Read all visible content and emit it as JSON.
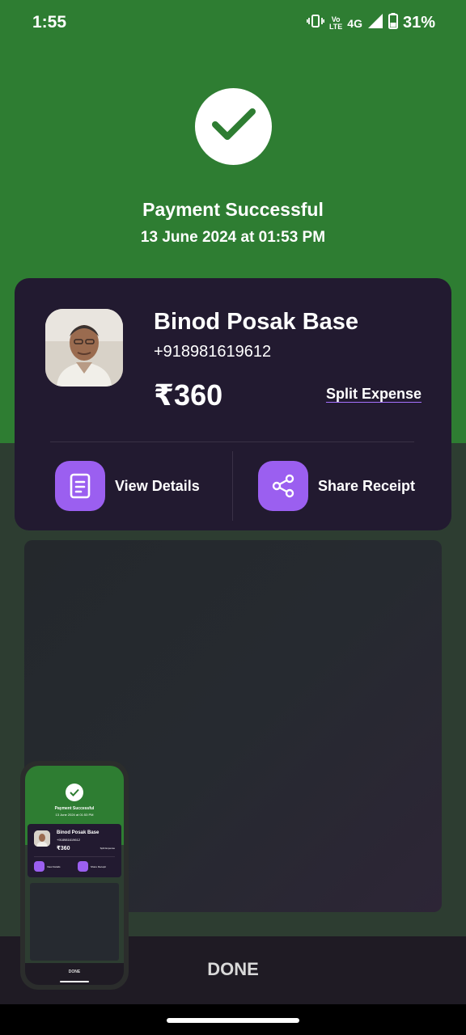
{
  "status_bar": {
    "time": "1:55",
    "network_top": "Vo",
    "network_bottom": "LTE",
    "network_type": "4G",
    "battery_percent": "31%"
  },
  "payment": {
    "title": "Payment Successful",
    "datetime": "13 June 2024 at 01:53 PM"
  },
  "payee": {
    "name": "Binod Posak Base",
    "phone": "+918981619612",
    "amount": "₹360"
  },
  "split_expense_label": "Split Expense",
  "actions": {
    "view_details": "View Details",
    "share_receipt": "Share Receipt"
  },
  "done_label": "DONE",
  "colors": {
    "success_green": "#2e7d32",
    "card_bg": "#221a30",
    "accent_purple": "#9b5ff0"
  },
  "icons": [
    "check-icon",
    "receipt-icon",
    "share-icon",
    "vibrate-icon",
    "signal-icon",
    "battery-icon"
  ]
}
